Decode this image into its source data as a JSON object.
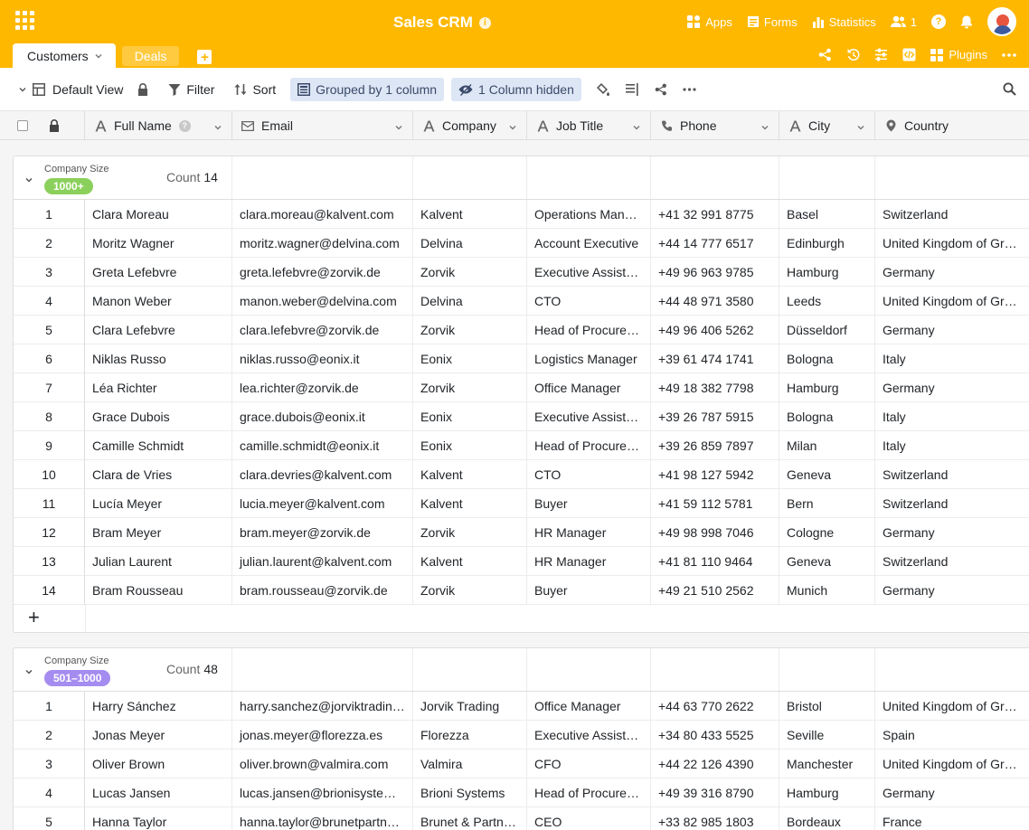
{
  "app": {
    "base_title": "Sales CRM",
    "info_glyph": "i",
    "accent": "#ffb800"
  },
  "top_nav": {
    "apps_label": "Apps",
    "forms_label": "Forms",
    "statistics_label": "Statistics",
    "collaborators_count": "1",
    "help_glyph": "?"
  },
  "tabs": {
    "active": "Customers",
    "other": "Deals",
    "add_glyph": "+",
    "plugins_label": "Plugins"
  },
  "toolbar": {
    "view_label": "Default View",
    "filter_label": "Filter",
    "sort_label": "Sort",
    "group_label": "Grouped by 1 column",
    "hidden_label": "1 Column hidden"
  },
  "columns": [
    {
      "label": "Full Name",
      "type_icon": "text-icon"
    },
    {
      "label": "Email",
      "type_icon": "email-icon"
    },
    {
      "label": "Company",
      "type_icon": "text-icon"
    },
    {
      "label": "Job Title",
      "type_icon": "text-icon"
    },
    {
      "label": "Phone",
      "type_icon": "phone-icon"
    },
    {
      "label": "City",
      "type_icon": "text-icon"
    },
    {
      "label": "Country",
      "type_icon": "location-icon"
    }
  ],
  "groups": [
    {
      "field": "Company Size",
      "value": "1000+",
      "badge_color": "#8bd05c",
      "count_label": "Count",
      "count": "14",
      "rows": [
        [
          "1",
          "Clara Moreau",
          "clara.moreau@kalvent.com",
          "Kalvent",
          "Operations Manager",
          "+41 32 991 8775",
          "Basel",
          "Switzerland"
        ],
        [
          "2",
          "Moritz Wagner",
          "moritz.wagner@delvina.com",
          "Delvina",
          "Account Executive",
          "+44 14 777 6517",
          "Edinburgh",
          "United Kingdom of Great Britain"
        ],
        [
          "3",
          "Greta Lefebvre",
          "greta.lefebvre@zorvik.de",
          "Zorvik",
          "Executive Assistant",
          "+49 96 963 9785",
          "Hamburg",
          "Germany"
        ],
        [
          "4",
          "Manon Weber",
          "manon.weber@delvina.com",
          "Delvina",
          "CTO",
          "+44 48 971 3580",
          "Leeds",
          "United Kingdom of Great Britain"
        ],
        [
          "5",
          "Clara Lefebvre",
          "clara.lefebvre@zorvik.de",
          "Zorvik",
          "Head of Procurement",
          "+49 96 406 5262",
          "Düsseldorf",
          "Germany"
        ],
        [
          "6",
          "Niklas Russo",
          "niklas.russo@eonix.it",
          "Eonix",
          "Logistics Manager",
          "+39 61 474 1741",
          "Bologna",
          "Italy"
        ],
        [
          "7",
          "Léa Richter",
          "lea.richter@zorvik.de",
          "Zorvik",
          "Office Manager",
          "+49 18 382 7798",
          "Hamburg",
          "Germany"
        ],
        [
          "8",
          "Grace Dubois",
          "grace.dubois@eonix.it",
          "Eonix",
          "Executive Assistant",
          "+39 26 787 5915",
          "Bologna",
          "Italy"
        ],
        [
          "9",
          "Camille Schmidt",
          "camille.schmidt@eonix.it",
          "Eonix",
          "Head of Procurement",
          "+39 26 859 7897",
          "Milan",
          "Italy"
        ],
        [
          "10",
          "Clara de Vries",
          "clara.devries@kalvent.com",
          "Kalvent",
          "CTO",
          "+41 98 127 5942",
          "Geneva",
          "Switzerland"
        ],
        [
          "11",
          "Lucía Meyer",
          "lucia.meyer@kalvent.com",
          "Kalvent",
          "Buyer",
          "+41 59 112 5781",
          "Bern",
          "Switzerland"
        ],
        [
          "12",
          "Bram Meyer",
          "bram.meyer@zorvik.de",
          "Zorvik",
          "HR Manager",
          "+49 98 998 7046",
          "Cologne",
          "Germany"
        ],
        [
          "13",
          "Julian Laurent",
          "julian.laurent@kalvent.com",
          "Kalvent",
          "HR Manager",
          "+41 81 110 9464",
          "Geneva",
          "Switzerland"
        ],
        [
          "14",
          "Bram Rousseau",
          "bram.rousseau@zorvik.de",
          "Zorvik",
          "Buyer",
          "+49 21 510 2562",
          "Munich",
          "Germany"
        ]
      ],
      "add_glyph": "+"
    },
    {
      "field": "Company Size",
      "value": "501–1000",
      "badge_color": "#a58cf0",
      "count_label": "Count",
      "count": "48",
      "rows": [
        [
          "1",
          "Harry Sánchez",
          "harry.sanchez@jorviktrading.co.uk",
          "Jorvik Trading",
          "Office Manager",
          "+44 63 770 2622",
          "Bristol",
          "United Kingdom of Great Britain"
        ],
        [
          "2",
          "Jonas Meyer",
          "jonas.meyer@florezza.es",
          "Florezza",
          "Executive Assistant",
          "+34 80 433 5525",
          "Seville",
          "Spain"
        ],
        [
          "3",
          "Oliver Brown",
          "oliver.brown@valmira.com",
          "Valmira",
          "CFO",
          "+44 22 126 4390",
          "Manchester",
          "United Kingdom of Great Britain"
        ],
        [
          "4",
          "Lucas Jansen",
          "lucas.jansen@brionisystems.de",
          "Brioni Systems",
          "Head of Procurement",
          "+49 39 316 8790",
          "Hamburg",
          "Germany"
        ],
        [
          "5",
          "Hanna Taylor",
          "hanna.taylor@brunetpartners.fr",
          "Brunet & Partners",
          "CEO",
          "+33 82 985 1803",
          "Bordeaux",
          "France"
        ]
      ]
    }
  ]
}
